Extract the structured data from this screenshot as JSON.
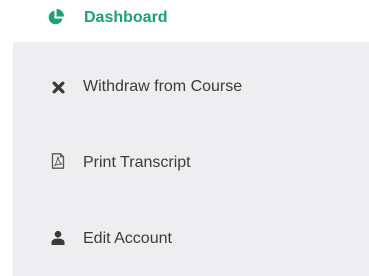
{
  "menu": {
    "active": {
      "label": "Dashboard",
      "icon": "pie-chart-icon",
      "color": "#1aa36f"
    },
    "items": [
      {
        "label": "Withdraw from Course",
        "icon": "close-icon"
      },
      {
        "label": "Print Transcript",
        "icon": "pdf-file-icon"
      },
      {
        "label": "Edit Account",
        "icon": "user-icon"
      }
    ],
    "background": "#eeeef0",
    "text_color": "#3b3b3b"
  }
}
